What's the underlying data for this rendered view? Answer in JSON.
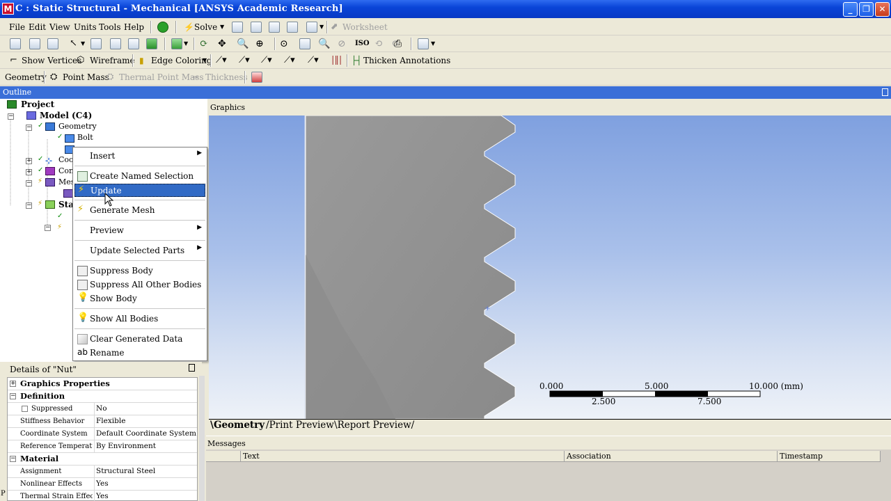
{
  "window": {
    "app_icon_letter": "M",
    "title": "C : Static Structural - Mechanical [ANSYS Academic Research]",
    "min": "_",
    "restore": "❐",
    "close": "✕"
  },
  "menubar": {
    "items": [
      "File",
      "Edit",
      "View",
      "Units",
      "Tools",
      "Help"
    ],
    "solve": "Solve",
    "worksheet": "Worksheet"
  },
  "toolbar3": {
    "show_vertices": "Show Vertices",
    "wireframe": "Wireframe",
    "edge_coloring": "Edge Coloring",
    "thicken_annotations": "Thicken Annotations"
  },
  "toolbar4": {
    "geometry": "Geometry",
    "point_mass": "Point Mass",
    "thermal_point_mass": "Thermal Point Mass",
    "thickness": "Thickness"
  },
  "outline": {
    "title": "Outline",
    "nodes": {
      "project": "Project",
      "model": "Model (C4)",
      "geometry": "Geometry",
      "bolt": "Bolt",
      "coord": "Coo",
      "conn": "Con",
      "mesh": "Mes",
      "static": "Sta"
    }
  },
  "context_menu": {
    "insert": "Insert",
    "create_named_selection": "Create Named Selection",
    "update": "Update",
    "generate_mesh": "Generate Mesh",
    "preview": "Preview",
    "update_selected_parts": "Update Selected Parts",
    "suppress_body": "Suppress Body",
    "suppress_all_other_bodies": "Suppress All Other Bodies",
    "show_body": "Show Body",
    "show_all_bodies": "Show All Bodies",
    "clear_generated_data": "Clear Generated Data",
    "rename": "Rename"
  },
  "details": {
    "title": "Details of \"Nut\"",
    "graphics_properties": "Graphics Properties",
    "definition": "Definition",
    "suppressed_k": "Suppressed",
    "suppressed_v": "No",
    "stiffness_k": "Stiffness Behavior",
    "stiffness_v": "Flexible",
    "coord_k": "Coordinate System",
    "coord_v": "Default Coordinate System",
    "reftemp_k": "Reference Temperature",
    "reftemp_v": "By Environment",
    "material": "Material",
    "assignment_k": "Assignment",
    "assignment_v": "Structural Steel",
    "nonlinear_k": "Nonlinear Effects",
    "nonlinear_v": "Yes",
    "thermal_k": "Thermal Strain Effects",
    "thermal_v": "Yes"
  },
  "graphics": {
    "title": "Graphics",
    "scale": {
      "l0": "0.000",
      "l1": "2.500",
      "l2": "5.000",
      "l3": "7.500",
      "l4": "10.000 (mm)"
    },
    "tabs": [
      "Geometry",
      "Print Preview",
      "Report Preview"
    ]
  },
  "messages": {
    "title": "Messages",
    "columns": [
      "Text",
      "Association",
      "Timestamp"
    ]
  },
  "status": {
    "p": "P"
  },
  "colors": {
    "title_blue": "#0a45d8",
    "selection_blue": "#316ac5",
    "model_gray": "#8c8c8c"
  }
}
